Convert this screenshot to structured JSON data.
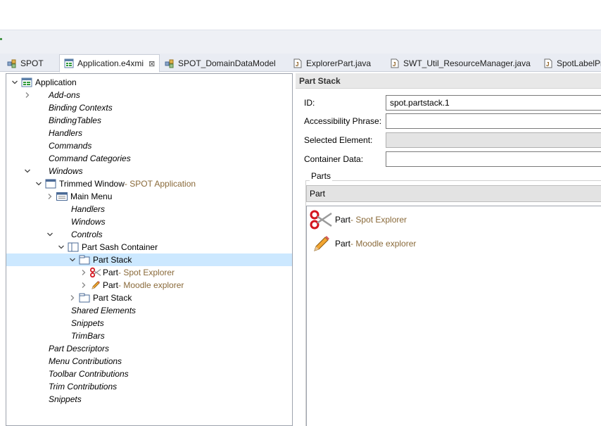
{
  "tabs": [
    {
      "label": "SPOT",
      "icon": "model-icon"
    },
    {
      "label": "Application.e4xmi",
      "icon": "application-model-icon",
      "close": "⊠"
    },
    {
      "label": "SPOT_DomainDataModel",
      "icon": "model-icon"
    },
    {
      "label": "ExplorerPart.java",
      "icon": "java-file-icon"
    },
    {
      "label": "SWT_Util_ResourceManager.java",
      "icon": "java-file-icon"
    },
    {
      "label": "SpotLabelPr",
      "icon": "java-file-icon"
    }
  ],
  "tree": {
    "application": "Application",
    "addons": "Add-ons",
    "binding_contexts": "Binding Contexts",
    "binding_tables": "BindingTables",
    "handlers": "Handlers",
    "commands": "Commands",
    "command_categories": "Command Categories",
    "windows": "Windows",
    "trimmed_window": "Trimmed Window",
    "trimmed_window_sub": " - SPOT Application",
    "main_menu": "Main Menu",
    "w_handlers": "Handlers",
    "w_windows": "Windows",
    "controls": "Controls",
    "part_sash_container": "Part Sash Container",
    "part_stack_1": "Part Stack",
    "part_1": "Part",
    "part_1_sub": " - Spot Explorer",
    "part_2": "Part",
    "part_2_sub": " - Moodle explorer",
    "part_stack_2": "Part Stack",
    "shared_elements": "Shared Elements",
    "snippets_w": "Snippets",
    "trimbars": "TrimBars",
    "part_descriptors": "Part Descriptors",
    "menu_contributions": "Menu Contributions",
    "toolbar_contributions": "Toolbar Contributions",
    "trim_contributions": "Trim Contributions",
    "snippets": "Snippets"
  },
  "detail": {
    "header": "Part Stack",
    "id_label": "ID:",
    "id_value": "spot.partstack.1",
    "accessibility_label": "Accessibility Phrase:",
    "accessibility_value": "",
    "selected_label": "Selected Element:",
    "selected_value": "",
    "container_label": "Container Data:",
    "container_value": "",
    "parts_group": "Parts",
    "parts_combo": "Part",
    "parts": [
      {
        "label": "Part",
        "sub": " - Spot Explorer",
        "icon": "scissors-icon"
      },
      {
        "label": "Part",
        "sub": " - Moodle explorer",
        "icon": "pencil-icon"
      }
    ]
  },
  "colors": {
    "selection": "#cce8ff",
    "sublabel": "#8a6a3a",
    "toolbar_bg": "#eef0f5"
  }
}
